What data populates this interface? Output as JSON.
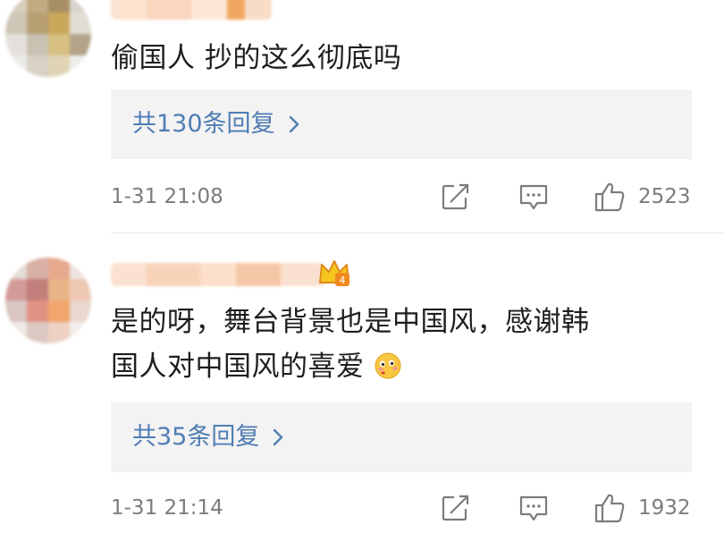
{
  "comments": [
    {
      "text": "偷国人 抄的这么彻底吗",
      "replies_label": "共130条回复",
      "timestamp": "1-31 21:08",
      "like_count": "2523"
    },
    {
      "text_line1": "是的呀，舞台背景也是中国风，感谢韩",
      "text_line2": "国人对中国风的喜爱",
      "replies_label": "共35条回复",
      "timestamp": "1-31 21:14",
      "like_count": "1932"
    }
  ],
  "icons": {
    "share": "share-icon",
    "comment": "comment-icon",
    "like": "thumbs-up-icon",
    "chevron": "chevron-right-icon",
    "emoji": "blush-kiss-emoji-icon",
    "badge": "crown-badge-icon"
  },
  "colors": {
    "link": "#4f7db4",
    "meta": "#7c7c7c",
    "text": "#1e1e1e",
    "reply_bg": "#f3f3f3"
  }
}
